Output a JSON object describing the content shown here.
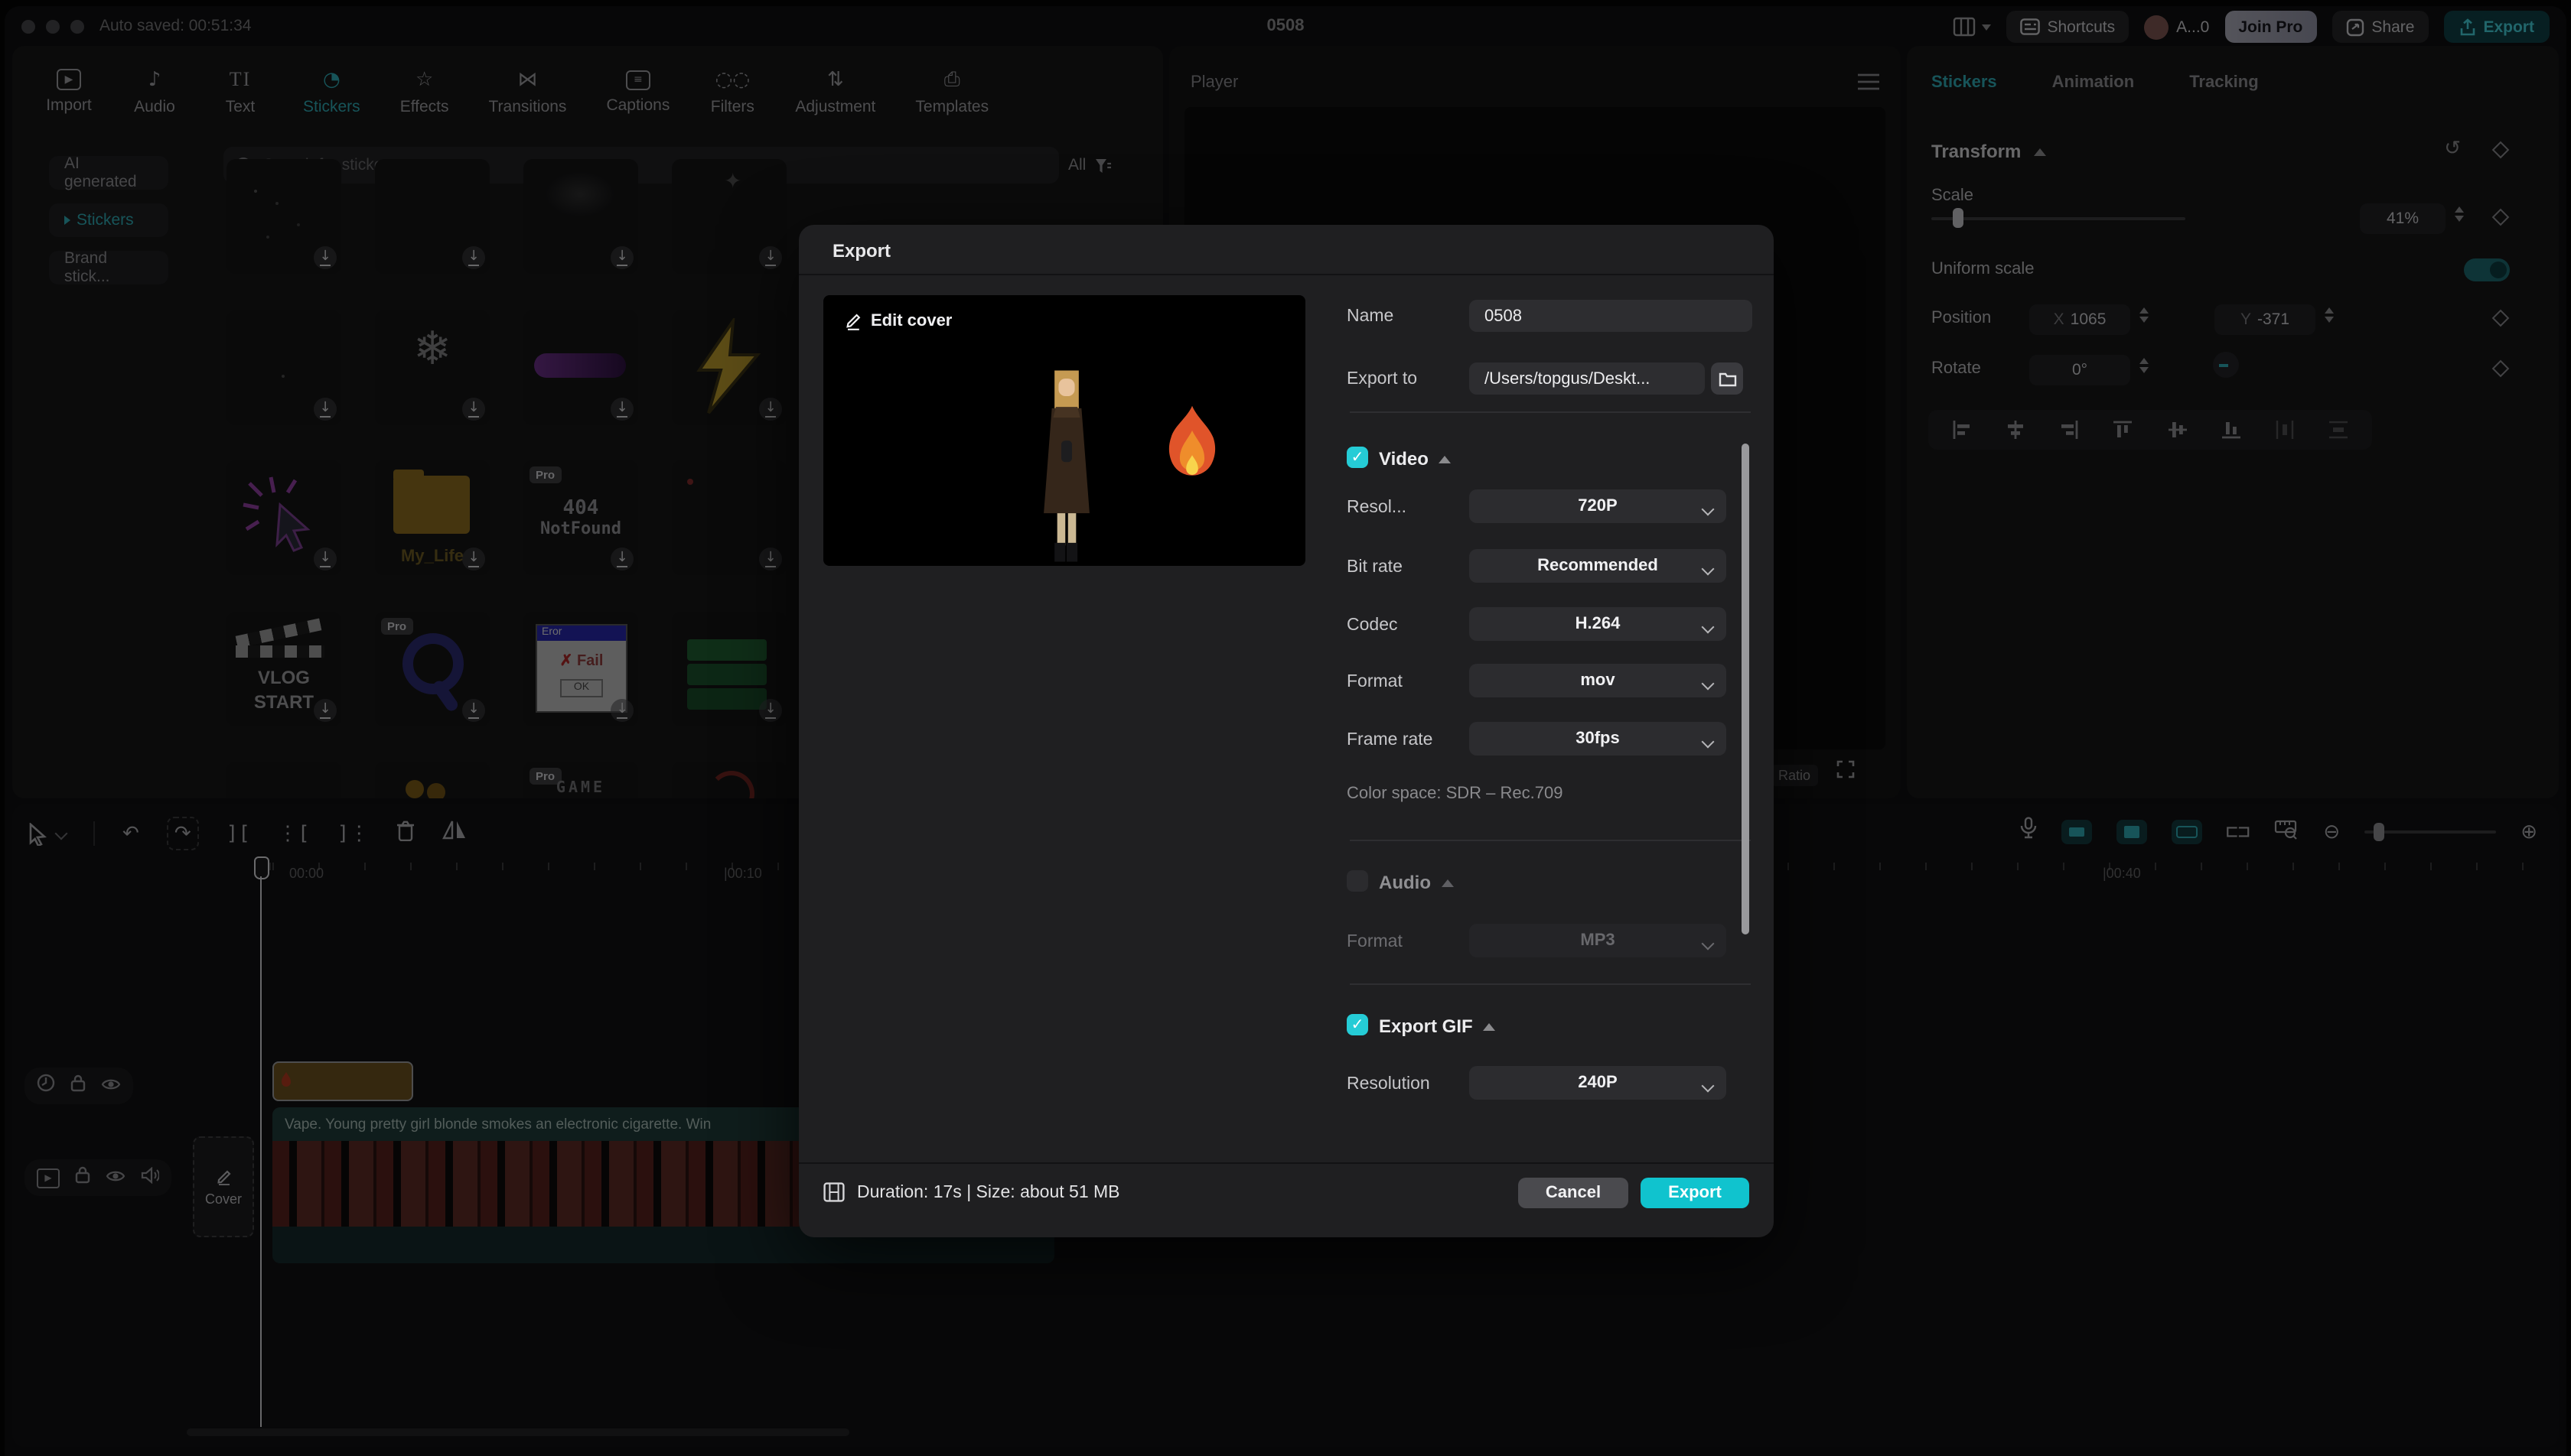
{
  "window": {
    "auto_saved": "Auto saved: 00:51:34",
    "title": "0508"
  },
  "topbar": {
    "shortcuts": "Shortcuts",
    "account": "A...0",
    "join_pro": "Join Pro",
    "share": "Share",
    "export": "Export"
  },
  "nav": {
    "items": [
      "Import",
      "Audio",
      "Text",
      "Stickers",
      "Effects",
      "Transitions",
      "Captions",
      "Filters",
      "Adjustment",
      "Templates"
    ]
  },
  "media": {
    "categories": [
      "AI generated",
      "Stickers",
      "Brand stick..."
    ],
    "search_placeholder": "Search for stickers",
    "filter": "All",
    "pro_badge": "Pro",
    "tiles": {
      "folder_label": "My_Life",
      "err404_1": "404",
      "err404_2": "NotFound",
      "vlog_1": "VLOG",
      "vlog_2": "START",
      "error_title": "Eror",
      "error_fail": "Fail",
      "error_ok": "OK",
      "game": "GAME"
    }
  },
  "player": {
    "label": "Player",
    "ratio": "Ratio"
  },
  "inspector": {
    "tabs": [
      "Stickers",
      "Animation",
      "Tracking"
    ],
    "section": "Transform",
    "scale_label": "Scale",
    "scale_value": "41%",
    "uniform_label": "Uniform scale",
    "position_label": "Position",
    "x_label": "X",
    "x_value": "1065",
    "y_label": "Y",
    "y_value": "-371",
    "rotate_label": "Rotate",
    "rotate_value": "0°"
  },
  "export_dialog": {
    "title": "Export",
    "edit_cover": "Edit cover",
    "name_label": "Name",
    "name_value": "0508",
    "export_to_label": "Export to",
    "export_to_value": "/Users/topgus/Deskt...",
    "video": {
      "label": "Video",
      "resolution_label": "Resol...",
      "resolution": "720P",
      "bitrate_label": "Bit rate",
      "bitrate": "Recommended",
      "codec_label": "Codec",
      "codec": "H.264",
      "format_label": "Format",
      "format": "mov",
      "framerate_label": "Frame rate",
      "framerate": "30fps",
      "color_space": "Color space: SDR – Rec.709"
    },
    "audio": {
      "label": "Audio",
      "format_label": "Format",
      "format": "MP3"
    },
    "gif": {
      "label": "Export GIF",
      "resolution_label": "Resolution",
      "resolution": "240P"
    },
    "footer": {
      "info": "Duration: 17s | Size: about 51 MB",
      "cancel": "Cancel",
      "export": "Export"
    }
  },
  "timeline": {
    "ruler_labels": [
      "00:00",
      "|00:10",
      "|00:40"
    ],
    "cover": "Cover",
    "caption": "Vape. Young pretty girl blonde smokes an electronic cigarette. Win"
  },
  "colors": {
    "accent": "#25ccd6",
    "export_button": "#10c3ce"
  }
}
